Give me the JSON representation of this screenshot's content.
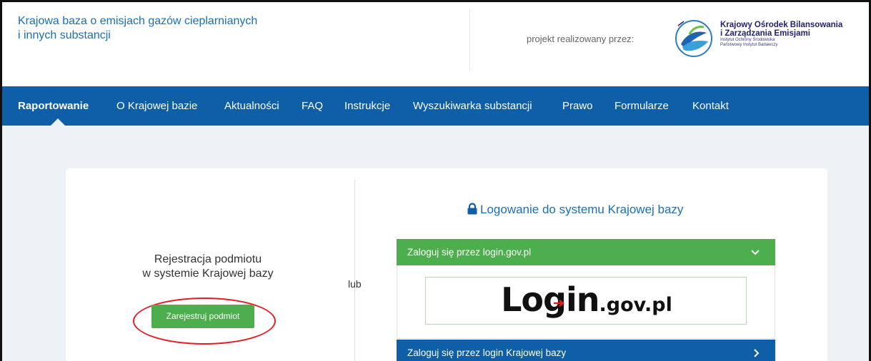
{
  "header": {
    "site_title_line1": "Krajowa baza o emisjach gazów cieplarnianych",
    "site_title_line2": "i innych substancji",
    "project_label": "projekt realizowany przez:",
    "partner": {
      "line1": "Krajowy Ośrodek Bilansowania",
      "line2": "i Zarządzania Emisjami",
      "line3": "Instytut Ochrony Środowiska",
      "line4": "Państwowy Instytut Badawczy"
    }
  },
  "nav": {
    "items": [
      {
        "label": "Raportowanie",
        "active": true
      },
      {
        "label": "O Krajowej bazie"
      },
      {
        "label": "Aktualności"
      },
      {
        "label": "FAQ"
      },
      {
        "label": "Instrukcje"
      },
      {
        "label": "Wyszukiwarka substancji"
      },
      {
        "label": "Prawo"
      },
      {
        "label": "Formularze"
      },
      {
        "label": "Kontakt"
      }
    ]
  },
  "registration": {
    "text_line1": "Rejestracja podmiotu",
    "text_line2": "w systemie Krajowej bazy",
    "button_label": "Zarejestruj podmiot"
  },
  "separator": "lub",
  "login": {
    "heading": "Logowanie do systemu Krajowej bazy",
    "gov_option_label": "Zaloguj się przez login.gov.pl",
    "gov_logo_big": "Login",
    "gov_logo_small": ".gov.pl",
    "local_option_label": "Zaloguj się przez login Krajowej bazy"
  },
  "colors": {
    "primary_blue": "#0f5ea8",
    "green": "#4cae4c",
    "highlight_red": "#e31e24"
  },
  "icons": [
    "lock-icon",
    "chevron-down-icon",
    "chevron-right-icon",
    "login-arrow-icon"
  ]
}
